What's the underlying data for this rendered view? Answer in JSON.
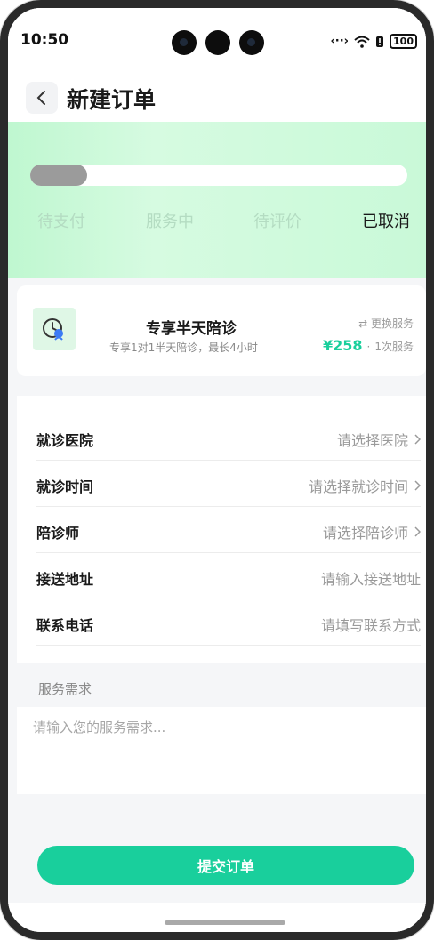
{
  "status_bar": {
    "time": "10:50",
    "battery": "100",
    "code_icon": "‹··›"
  },
  "nav": {
    "title": "新建订单"
  },
  "progress": {
    "fraction": 0.15,
    "steps": [
      {
        "label": "待支付",
        "active": false
      },
      {
        "label": "服务中",
        "active": false
      },
      {
        "label": "待评价",
        "active": false
      },
      {
        "label": "已取消",
        "active": true
      }
    ]
  },
  "service": {
    "name": "专享半天陪诊",
    "description": "专享1对1半天陪诊，最长4小时",
    "change_label": "更换服务",
    "change_icon": "⇄",
    "price": "¥258",
    "separator": "·",
    "count": "1次服务"
  },
  "form": {
    "rows": [
      {
        "label": "就诊医院",
        "value": "请选择医院",
        "has_arrow": true
      },
      {
        "label": "就诊时间",
        "value": "请选择就诊时间",
        "has_arrow": true
      },
      {
        "label": "陪诊师",
        "value": "请选择陪诊师",
        "has_arrow": true
      },
      {
        "label": "接送地址",
        "value": "请输入接送地址",
        "has_arrow": false
      },
      {
        "label": "联系电话",
        "value": "请填写联系方式",
        "has_arrow": false
      }
    ]
  },
  "requirements": {
    "title": "服务需求",
    "placeholder": "请输入您的服务需求..."
  },
  "submit": {
    "label": "提交订单"
  },
  "colors": {
    "accent": "#19cf9c",
    "header_gradient": "#c9f9d8",
    "progress_fill": "#9b9b9b",
    "step_inactive": "#b4dcc2"
  }
}
